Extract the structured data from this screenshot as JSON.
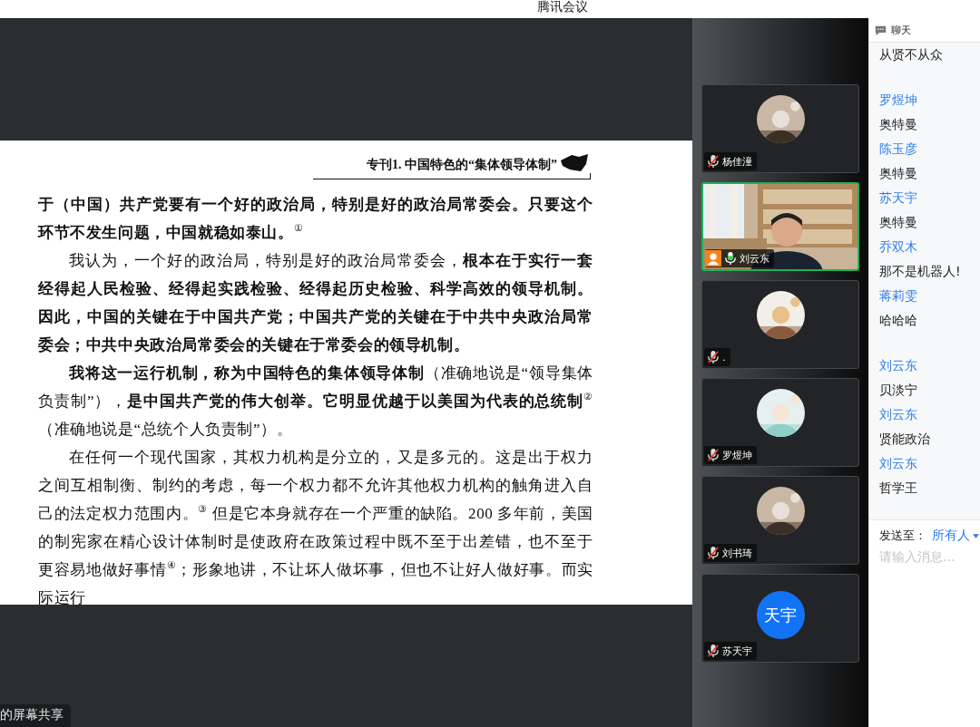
{
  "window": {
    "title": "腾讯会议"
  },
  "document": {
    "header": "专刊1. 中国特色的“集体领导体制”",
    "paragraphs": [
      {
        "indent": false,
        "text": "**于（中国）共产党要有一个好的政治局，特别是好的政治局常委会。只要这个环节不发生问题，中国就稳如泰山。**$^{①}$"
      },
      {
        "indent": true,
        "text": "我认为，一个好的政治局，特别是好的政治局常委会，**根本在于实行一套经得起人民检验、经得起实践检验、经得起历史检验、科学高效的领导机制。因此，中国的关键在于中国共产党；中国共产党的关键在于中共中央政治局常委会；中共中央政治局常委会的关键在于常委会的领导机制。**"
      },
      {
        "indent": true,
        "text": "**我将这一运行机制，称为中国特色的集体领导体制**（准确地说是“领导集体负责制”），**是中国共产党的伟大创举。它明显优越于以美国为代表的总统制**$^{②}$（准确地说是“总统个人负责制”）。"
      },
      {
        "indent": true,
        "text": "在任何一个现代国家，其权力机构是分立的，又是多元的。这是出于权力之间互相制衡、制约的考虑，每一个权力都不允许其他权力机构的触角进入自己的法定权力范围内。$^{③}$ 但是它本身就存在一个严重的缺陷。200 多年前，美国的制宪家在精心设计体制时是使政府在政策过程中既不至于出差错，也不至于更容易地做好事情$^{④}$；形象地讲，不让坏人做坏事，但也不让好人做好事。而实际运行"
      }
    ]
  },
  "share_label": "的屏幕共享",
  "participants": [
    {
      "name": "杨佳潼",
      "kind": "avatar",
      "muted": true,
      "active": false,
      "host": false
    },
    {
      "name": "刘云东",
      "kind": "video",
      "muted": false,
      "active": true,
      "host": true
    },
    {
      "name": ".",
      "kind": "avatar",
      "muted": true,
      "active": false,
      "host": false
    },
    {
      "name": "罗煜坤",
      "kind": "avatar",
      "muted": true,
      "active": false,
      "host": false
    },
    {
      "name": "刘书琦",
      "kind": "avatar",
      "muted": true,
      "active": false,
      "host": false
    },
    {
      "name": "苏天宇",
      "kind": "initials",
      "initials": "天宇",
      "muted": true,
      "active": false,
      "host": false
    }
  ],
  "chat": {
    "title": "聊天",
    "blocks": [
      [
        {
          "kind": "text",
          "text": "从贤不从众"
        }
      ],
      [
        {
          "kind": "sender",
          "text": "罗煜坤"
        },
        {
          "kind": "text",
          "text": "奥特曼"
        },
        {
          "kind": "sender",
          "text": "陈玉彦"
        },
        {
          "kind": "text",
          "text": "奥特曼"
        },
        {
          "kind": "sender",
          "text": "苏天宇"
        },
        {
          "kind": "text",
          "text": "奥特曼"
        },
        {
          "kind": "sender",
          "text": "乔双木"
        },
        {
          "kind": "text",
          "text": "那不是机器人!"
        },
        {
          "kind": "sender",
          "text": "蒋莉雯"
        },
        {
          "kind": "text",
          "text": "哈哈哈"
        }
      ],
      [
        {
          "kind": "sender",
          "text": "刘云东"
        },
        {
          "kind": "text",
          "text": "贝淡宁"
        },
        {
          "kind": "sender",
          "text": "刘云东"
        },
        {
          "kind": "text",
          "text": "贤能政治"
        },
        {
          "kind": "sender",
          "text": "刘云东"
        },
        {
          "kind": "text",
          "text": "哲学王"
        }
      ]
    ],
    "send_to_label": "发送至：",
    "recipient": "所有人",
    "placeholder": "请输入消息..."
  }
}
